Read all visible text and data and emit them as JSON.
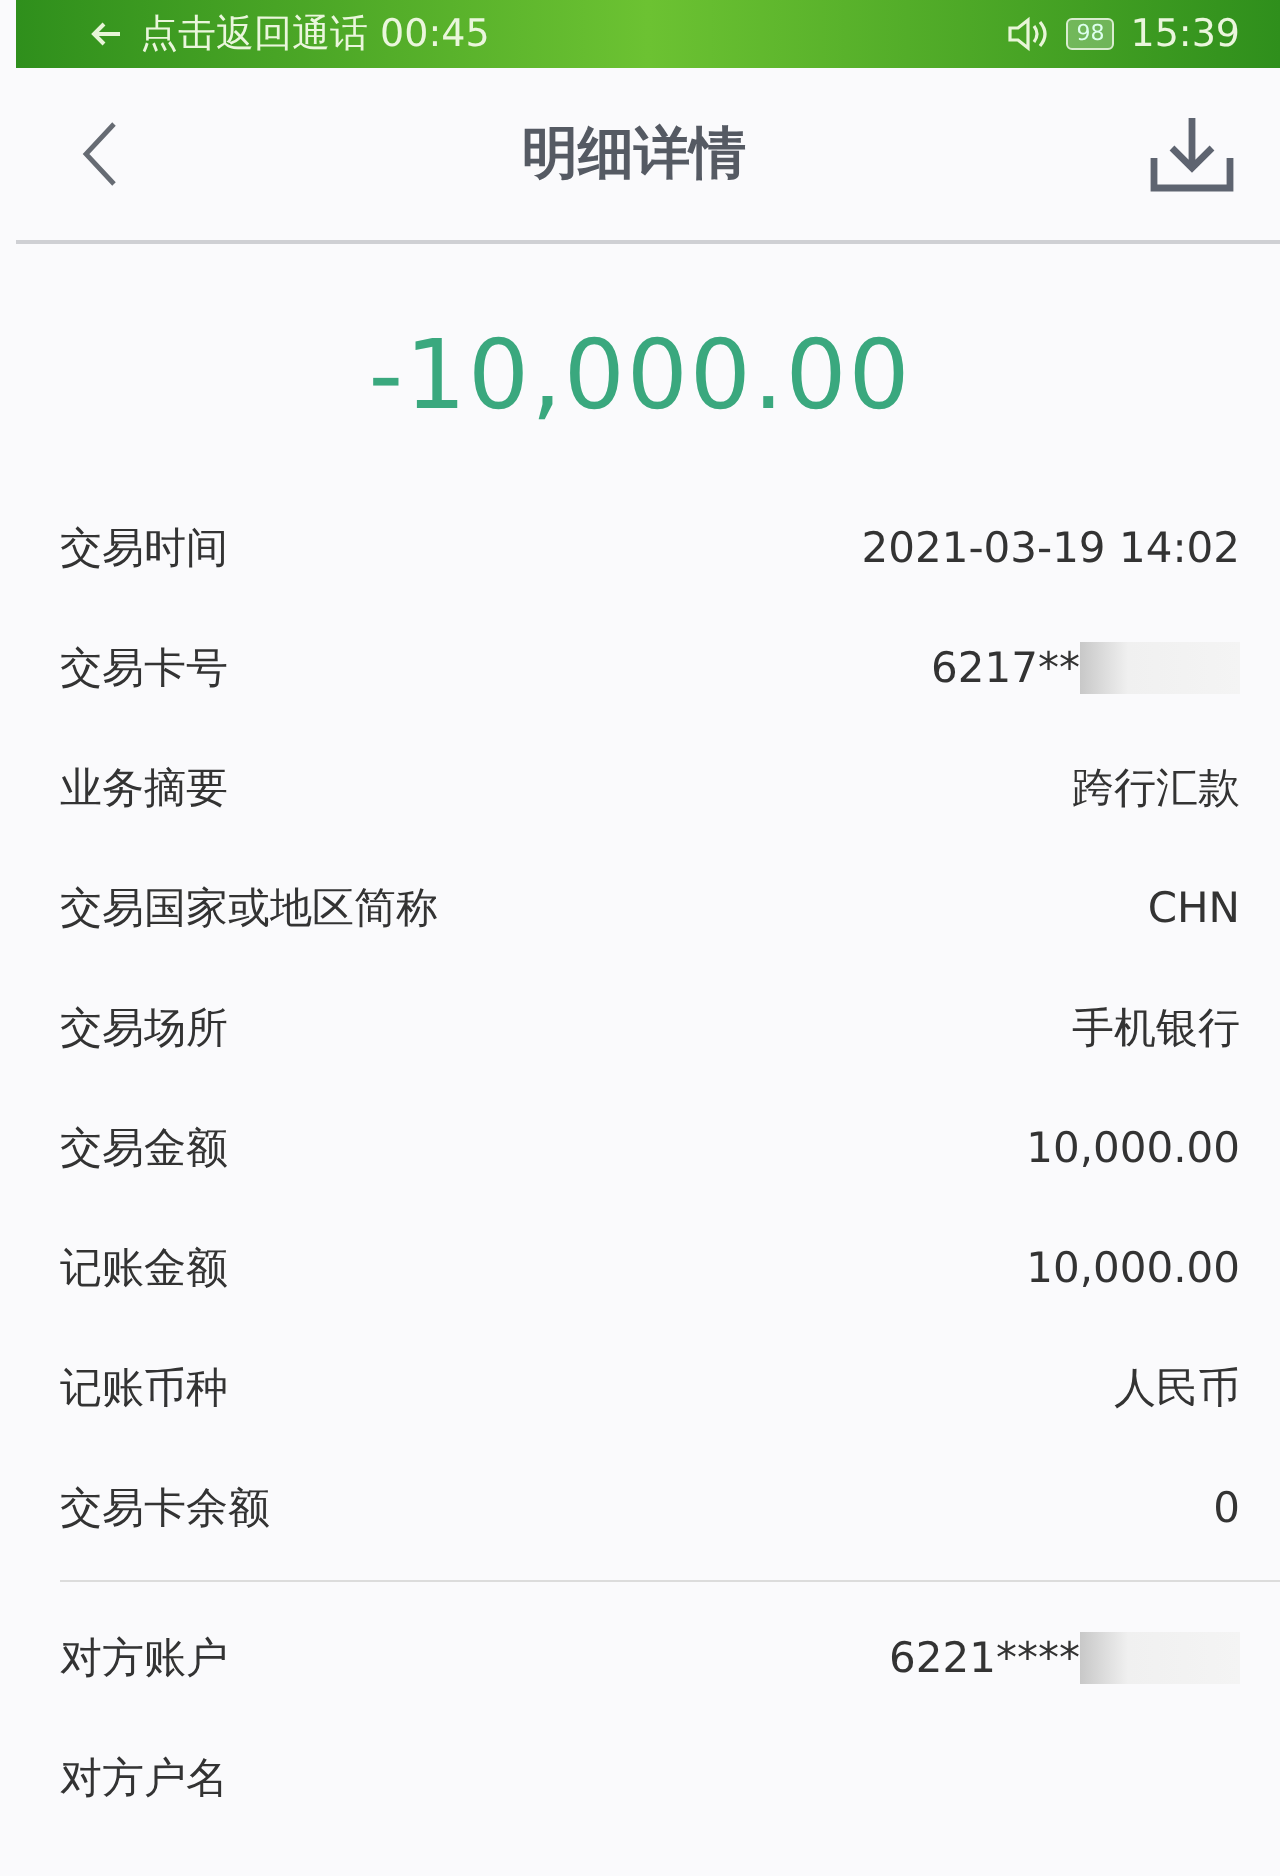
{
  "status_bar": {
    "call_text": "点击返回通话 00:45",
    "battery": "98",
    "time": "15:39"
  },
  "header": {
    "title": "明细详情"
  },
  "amount": "-10,000.00",
  "details": [
    {
      "label": "交易时间",
      "value": "2021-03-19 14:02"
    },
    {
      "label": "交易卡号",
      "value": "6217**",
      "redacted": true
    },
    {
      "label": "业务摘要",
      "value": "跨行汇款"
    },
    {
      "label": "交易国家或地区简称",
      "value": "CHN"
    },
    {
      "label": "交易场所",
      "value": "手机银行"
    },
    {
      "label": "交易金额",
      "value": "10,000.00"
    },
    {
      "label": "记账金额",
      "value": "10,000.00"
    },
    {
      "label": "记账币种",
      "value": "人民币"
    },
    {
      "label": "交易卡余额",
      "value": "0"
    }
  ],
  "counterparty": [
    {
      "label": "对方账户",
      "value": "6221****",
      "redacted": true
    },
    {
      "label": "对方户名"
    }
  ]
}
